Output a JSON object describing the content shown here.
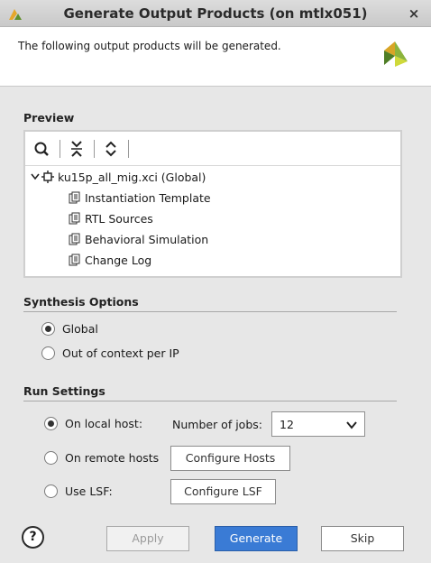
{
  "window": {
    "title": "Generate Output Products (on mtlx051)",
    "close_glyph": "×",
    "app_icon": "xilinx-logo-icon"
  },
  "header": {
    "message": "The following output products will be generated.",
    "logo": "vivado-logo-icon"
  },
  "preview": {
    "title": "Preview",
    "toolbar": [
      "search-icon",
      "collapse-all-icon",
      "expand-all-icon"
    ],
    "tree": {
      "root": "ku15p_all_mig.xci (Global)",
      "children": [
        "Instantiation Template",
        "RTL Sources",
        "Behavioral Simulation",
        "Change Log"
      ]
    }
  },
  "synthesis": {
    "title": "Synthesis Options",
    "options": [
      {
        "label": "Global",
        "checked": true
      },
      {
        "label": "Out of context per IP",
        "checked": false
      }
    ]
  },
  "run": {
    "title": "Run Settings",
    "local_label": "On local host:",
    "remote_label": "On remote hosts",
    "lsf_label": "Use LSF:",
    "jobs_label": "Number of jobs:",
    "jobs_value": "12",
    "configure_hosts": "Configure Hosts",
    "configure_lsf": "Configure LSF"
  },
  "footer": {
    "help": "?",
    "apply": "Apply",
    "generate": "Generate",
    "skip": "Skip"
  },
  "colors": {
    "primary": "#3a7bd5",
    "background": "#e7e7e7"
  }
}
